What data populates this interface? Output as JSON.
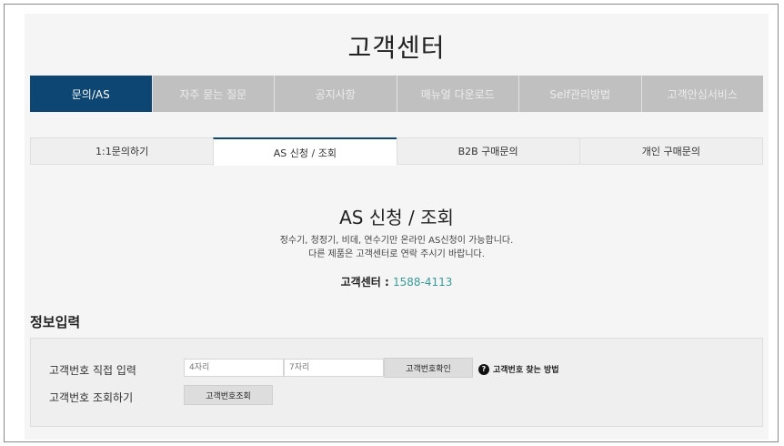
{
  "header": {
    "title": "고객센터"
  },
  "main_nav": {
    "items": [
      {
        "label": "문의/AS"
      },
      {
        "label": "자주 묻는 질문"
      },
      {
        "label": "공지사항"
      },
      {
        "label": "매뉴얼 다운로드"
      },
      {
        "label": "Self관리방법"
      },
      {
        "label": "고객안심서비스"
      }
    ],
    "active_index": 0
  },
  "sub_tabs": {
    "items": [
      {
        "label": "1:1문의하기"
      },
      {
        "label": "AS 신청 / 조회"
      },
      {
        "label": "B2B 구매문의"
      },
      {
        "label": "개인 구매문의"
      }
    ],
    "active_index": 1
  },
  "section": {
    "title": "AS 신청 / 조회",
    "desc_line1": "정수기, 청정기, 비데, 연수기만 온라인 AS신청이 가능합니다.",
    "desc_line2": "다른 제품은 고객센터로 연락 주시기 바랍니다.",
    "phone_label": "고객센터 :",
    "phone_number": "1588-4113"
  },
  "info": {
    "heading": "정보입력",
    "direct_label": "고객번호 직접 입력",
    "input1_placeholder": "4자리",
    "input2_placeholder": "7자리",
    "confirm_button": "고객번호확인",
    "help_link": "고객번호 찾는 방법",
    "lookup_label": "고객번호 조회하기",
    "lookup_button": "고객번호조회"
  },
  "colors": {
    "accent": "#0d4672",
    "phone": "#3a9a98",
    "nav_inactive": "#c0c0c0"
  }
}
